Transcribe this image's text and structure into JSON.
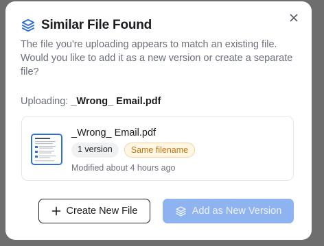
{
  "dialog": {
    "title": "Similar File Found",
    "description": "The file you're uploading appears to match an existing file. Would you like to add it as a new version or create a separate file?",
    "uploading_label": "Uploading:",
    "uploading_filename": "_Wrong_ Email.pdf"
  },
  "existing_file": {
    "name": "_Wrong_ Email.pdf",
    "version_badge": "1 version",
    "match_badge": "Same filename",
    "modified": "Modified about 4 hours ago"
  },
  "actions": {
    "create_label": "Create New File",
    "add_version_label": "Add as New Version"
  },
  "icons": {
    "header": "layers-icon",
    "close": "close-icon",
    "create": "plus-icon",
    "add_version": "layers-icon",
    "thumbnail": "document-thumbnail"
  },
  "colors": {
    "accent": "#2f6fd8",
    "primary_button_disabled": "#8fb3f0",
    "warning_text": "#c4780c",
    "warning_bg": "#fff6e6"
  }
}
